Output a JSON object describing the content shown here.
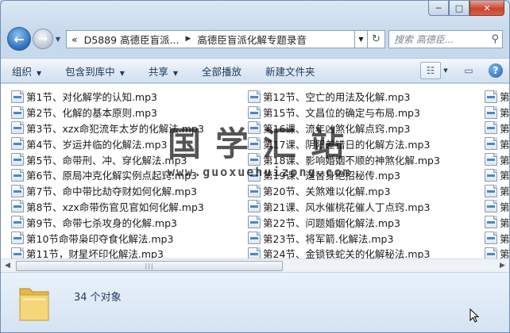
{
  "window": {
    "caption": {
      "minimize": "─",
      "maximize": "□",
      "close": "✕"
    }
  },
  "nav": {
    "back_glyph": "←",
    "forward_glyph": "→",
    "address_prefix": "«",
    "address_parts": [
      "D5889 高德臣盲派...",
      "高德臣盲派化解专题录音"
    ],
    "refresh_glyph": "↻",
    "search_placeholder": "搜索 高德臣..."
  },
  "toolbar": {
    "organize": "组织",
    "include": "包含到库中",
    "share": "共享",
    "play_all": "全部播放",
    "new_folder": "新建文件夹",
    "help": "?"
  },
  "files": {
    "column1": [
      "第1节、对化解学的认知.mp3",
      "第2节、化解的基本原则.mp3",
      "第3节、xzx命犯流年太岁的化解法.mp3",
      "第4节、岁运并临的化解法.mp3",
      "第5节、命带刑、冲、穿化解法.mp3",
      "第6节、原局冲克化解实例点起窍.mp3",
      "第7节、命中带比劫夺财如何化解.mp3",
      "第8节、xzx命带伤官见官如何化解.mp3",
      "第9节、命带七杀攻身的化解.mp3",
      "第10节命带枭印夺食化解法.mp3",
      "第11节，财星坏印化解法.mp3"
    ],
    "column2": [
      "第12节、空亡的用法及化解.mp3",
      "第15节、文昌位的确定与布局.mp3",
      "第16课、流年凶煞化解点窍.mp3",
      "第17课、阴阳差错日的化解方法.mp3",
      "第18课、影响婚姻不顺的神煞化解.mp3",
      "第19课、送替身绝招秘传.mp3",
      "第20节、关煞难以化解.mp3",
      "第21课、风水催桃花催人丁点窍.mp3",
      "第22节、问题婚姻化解法.mp3",
      "第23节、将军箭.化解法.mp3",
      "第24节、金锁铁蛇关的化解秘法.mp3"
    ],
    "column3": [
      "第",
      "第",
      "第",
      "第",
      "第",
      "第",
      "第",
      "第",
      "第",
      "第",
      "第"
    ]
  },
  "scrollbar": {
    "left_arrow": "◀",
    "right_arrow": "▶",
    "grip": "|||"
  },
  "status": {
    "count_text": "34 个对象"
  },
  "watermark": {
    "title": "国学汇站",
    "url": "www.guoxuehuizong.com"
  },
  "colors": {
    "accent": "#2b6cb8",
    "toolbar_text": "#1e395b",
    "close": "#c9452d"
  }
}
